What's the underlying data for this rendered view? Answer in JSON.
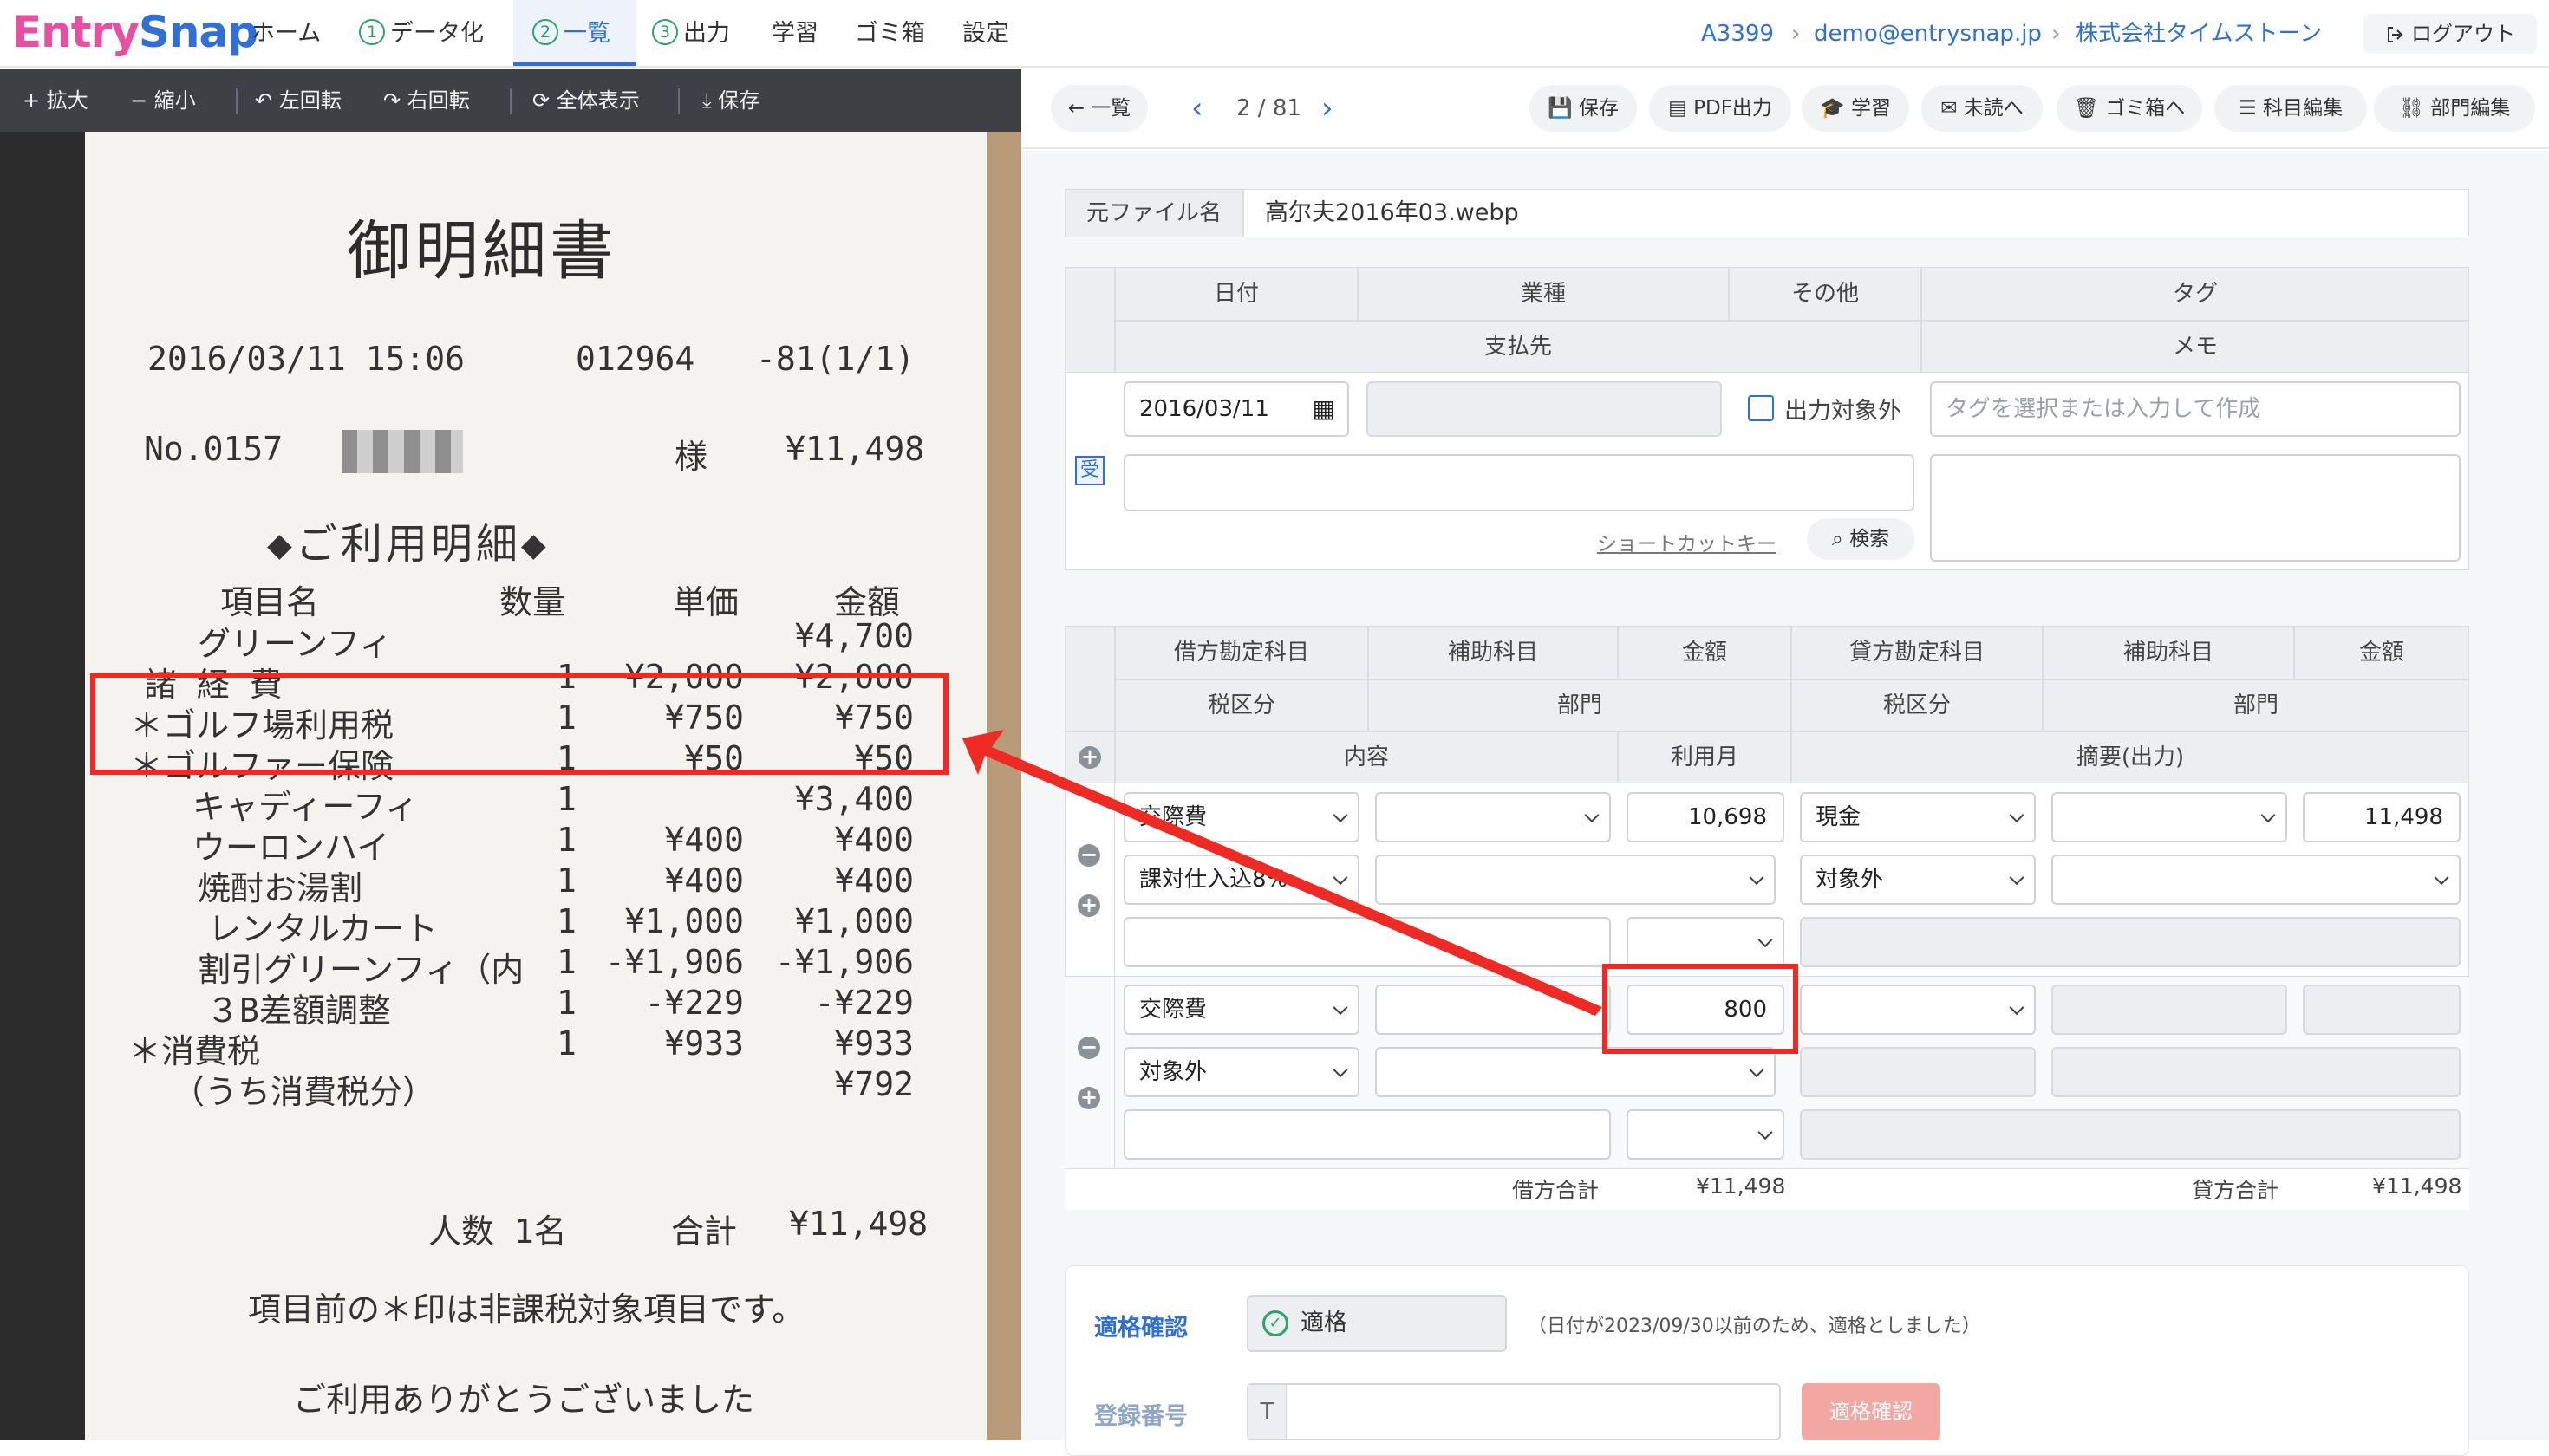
{
  "app": {
    "logo_entry": "Entry",
    "logo_snap": "Snap"
  },
  "nav": {
    "home": "ホーム",
    "data": "データ化",
    "list": "一覧",
    "output": "出力",
    "learn": "学習",
    "trash": "ゴミ箱",
    "settings": "設定",
    "step1": "1",
    "step2": "2",
    "step3": "3"
  },
  "account": {
    "id": "A3399",
    "email": "demo@entrysnap.jp",
    "company": "株式会社タイムストーン",
    "sep": "›",
    "logout": "ログアウト"
  },
  "viewer": {
    "zoom_in": "拡大",
    "zoom_out": "縮小",
    "rotate_left": "左回転",
    "rotate_right": "右回転",
    "fit": "全体表示",
    "save": "保存"
  },
  "receipt": {
    "title": "御明細書",
    "datetime": "2016/03/11 15:06",
    "code": "012964",
    "page": "-81(1/1)",
    "no": "No.0157",
    "sama": "様",
    "total_top": "¥11,498",
    "section": "◆ご利用明細◆",
    "headers": [
      "項目名",
      "数量",
      "単価",
      "金額"
    ],
    "rows": [
      {
        "name": "グリーンフィ",
        "qty": "",
        "price": "",
        "amount": "¥4,700"
      },
      {
        "name": "諸 経 費",
        "qty": "1",
        "price": "¥2,000",
        "amount": "¥2,000"
      },
      {
        "name": "＊ゴルフ場利用税",
        "qty": "1",
        "price": "¥750",
        "amount": "¥750"
      },
      {
        "name": "＊ゴルファー保険",
        "qty": "1",
        "price": "¥50",
        "amount": "¥50"
      },
      {
        "name": "キャディーフィ",
        "qty": "1",
        "price": "",
        "amount": "¥3,400"
      },
      {
        "name": "ウーロンハイ",
        "qty": "1",
        "price": "¥400",
        "amount": "¥400"
      },
      {
        "name": "焼酎お湯割",
        "qty": "1",
        "price": "¥400",
        "amount": "¥400"
      },
      {
        "name": "レンタルカート",
        "qty": "1",
        "price": "¥1,000",
        "amount": "¥1,000"
      },
      {
        "name": "割引グリーンフィ（内",
        "qty": "1",
        "price": "-¥1,906",
        "amount": "-¥1,906"
      },
      {
        "name": "３B差額調整",
        "qty": "1",
        "price": "-¥229",
        "amount": "-¥229"
      },
      {
        "name": "＊消費税",
        "qty": "1",
        "price": "¥933",
        "amount": "¥933"
      },
      {
        "name": "（うち消費税分）",
        "qty": "",
        "price": "",
        "amount": "¥792"
      }
    ],
    "people": "人数 1名",
    "total_label": "合計",
    "total": "¥11,498",
    "note": "項目前の＊印は非課税対象項目です。",
    "thanks": "ご利用ありがとうございました"
  },
  "toolbar": {
    "back": "一覧",
    "page": "2 / 81",
    "save": "保存",
    "pdf": "PDF出力",
    "learn": "学習",
    "unread": "未読へ",
    "trash": "ゴミ箱へ",
    "subject_edit": "科目編集",
    "dept_edit": "部門編集"
  },
  "file": {
    "label": "元ファイル名",
    "name": "高尔夫2016年03.webp"
  },
  "header_form": {
    "date_label": "日付",
    "industry_label": "業種",
    "other_label": "その他",
    "tag_label": "タグ",
    "payee_label": "支払先",
    "memo_label": "メモ",
    "date_value": "2016/03/11",
    "exclude_label": "出力対象外",
    "tag_placeholder": "タグを選択または入力して作成",
    "shortcut": "ショートカットキー",
    "search": "検索",
    "receipt_badge": "受"
  },
  "journal": {
    "headers_row1": [
      "借方勘定科目",
      "補助科目",
      "金額",
      "貸方勘定科目",
      "補助科目",
      "金額"
    ],
    "headers_row2": [
      "税区分",
      "部門",
      "税区分",
      "部門"
    ],
    "headers_row3": [
      "内容",
      "利用月",
      "摘要(出力)"
    ],
    "entries": [
      {
        "debit": "交際費",
        "debit_amount": "10,698",
        "debit_tax": "課対仕入込8%",
        "credit": "現金",
        "credit_amount": "11,498",
        "credit_tax": "対象外"
      },
      {
        "debit": "交際費",
        "debit_amount": "800",
        "debit_tax": "対象外",
        "credit": "",
        "credit_amount": "",
        "credit_tax": ""
      }
    ],
    "debit_total_label": "借方合計",
    "debit_total": "¥11,498",
    "credit_total_label": "貸方合計",
    "credit_total": "¥11,498"
  },
  "qualification": {
    "label": "適格確認",
    "status": "適格",
    "note": "（日付が2023/09/30以前のため、適格としました）",
    "reg_label": "登録番号",
    "reg_prefix": "T",
    "check_button": "適格確認"
  },
  "colors": {
    "accent": "#2f6fd6",
    "highlight": "#ee2a24",
    "success": "#2aa564"
  }
}
